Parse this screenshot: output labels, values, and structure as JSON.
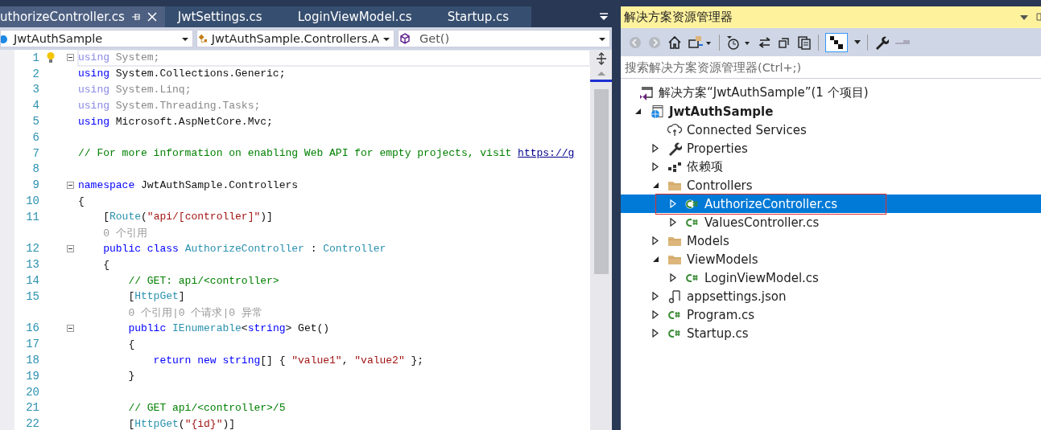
{
  "editor": {
    "tabs": [
      {
        "label": "uthorizeController.cs",
        "selected": true
      },
      {
        "label": "JwtSettings.cs",
        "selected": false
      },
      {
        "label": "LoginViewModel.cs",
        "selected": false
      },
      {
        "label": "Startup.cs",
        "selected": false
      }
    ],
    "nav": {
      "project": "JwtAuthSample",
      "type": "JwtAuthSample.Controllers.A",
      "member": "Get()"
    },
    "lines": [
      {
        "kind": "code",
        "number": "1",
        "fold": true,
        "current": true,
        "tokens": [
          {
            "kind": "unused_keyword",
            "s": "using"
          },
          {
            "kind": "unused",
            "s": " System;"
          }
        ]
      },
      {
        "kind": "code",
        "number": "2",
        "tokens": [
          {
            "kind": "keyword",
            "s": "using"
          },
          {
            "kind": "plain",
            "s": " System.Collections.Generic;"
          }
        ]
      },
      {
        "kind": "code",
        "number": "3",
        "tokens": [
          {
            "kind": "unused_keyword",
            "s": "using"
          },
          {
            "kind": "unused",
            "s": " System.Linq;"
          }
        ]
      },
      {
        "kind": "code",
        "number": "4",
        "tokens": [
          {
            "kind": "unused_keyword",
            "s": "using"
          },
          {
            "kind": "unused",
            "s": " System.Threading.Tasks;"
          }
        ]
      },
      {
        "kind": "code",
        "number": "5",
        "tokens": [
          {
            "kind": "keyword",
            "s": "using"
          },
          {
            "kind": "plain",
            "s": " Microsoft.AspNetCore.Mvc;"
          }
        ]
      },
      {
        "kind": "code",
        "number": "6"
      },
      {
        "kind": "code",
        "number": "7",
        "tokens": [
          {
            "kind": "comment",
            "s": "// For more information on enabling Web API for empty projects, visit "
          },
          {
            "kind": "link",
            "s": "https://g"
          }
        ]
      },
      {
        "kind": "code",
        "number": "8"
      },
      {
        "kind": "code",
        "number": "9",
        "fold": true,
        "tokens": [
          {
            "kind": "keyword",
            "s": "namespace"
          },
          {
            "kind": "plain",
            "s": " JwtAuthSample.Controllers"
          }
        ]
      },
      {
        "kind": "code",
        "number": "10",
        "tokens": [
          {
            "kind": "plain",
            "s": "{"
          }
        ]
      },
      {
        "kind": "code",
        "number": "11",
        "tokens": [
          {
            "kind": "plain",
            "s": "    ["
          },
          {
            "kind": "type",
            "s": "Route"
          },
          {
            "kind": "plain",
            "s": "("
          },
          {
            "kind": "string",
            "s": "\"api/[controller]\""
          },
          {
            "kind": "plain",
            "s": ")]"
          }
        ]
      },
      {
        "kind": "lens",
        "text": "    0 个引用"
      },
      {
        "kind": "code",
        "number": "12",
        "fold": true,
        "tokens": [
          {
            "kind": "keyword",
            "s": "    public class "
          },
          {
            "kind": "type",
            "s": "AuthorizeController"
          },
          {
            "kind": "plain",
            "s": " : "
          },
          {
            "kind": "type",
            "s": "Controller"
          }
        ]
      },
      {
        "kind": "code",
        "number": "13",
        "tokens": [
          {
            "kind": "plain",
            "s": "    {"
          }
        ]
      },
      {
        "kind": "code",
        "number": "14",
        "tokens": [
          {
            "kind": "comment",
            "s": "        // GET: api/<controller>"
          }
        ]
      },
      {
        "kind": "code",
        "number": "15",
        "tokens": [
          {
            "kind": "plain",
            "s": "        ["
          },
          {
            "kind": "type",
            "s": "HttpGet"
          },
          {
            "kind": "plain",
            "s": "]"
          }
        ]
      },
      {
        "kind": "lens",
        "text": "        0 个引用|0 个请求|0 异常"
      },
      {
        "kind": "code",
        "number": "16",
        "fold": true,
        "tokens": [
          {
            "kind": "keyword",
            "s": "        public "
          },
          {
            "kind": "type",
            "s": "IEnumerable"
          },
          {
            "kind": "plain",
            "s": "<"
          },
          {
            "kind": "keyword",
            "s": "string"
          },
          {
            "kind": "plain",
            "s": "> Get()"
          }
        ]
      },
      {
        "kind": "code",
        "number": "17",
        "tokens": [
          {
            "kind": "plain",
            "s": "        {"
          }
        ]
      },
      {
        "kind": "code",
        "number": "18",
        "tokens": [
          {
            "kind": "keyword",
            "s": "            return new string"
          },
          {
            "kind": "plain",
            "s": "[] { "
          },
          {
            "kind": "string",
            "s": "\"value1\""
          },
          {
            "kind": "plain",
            "s": ", "
          },
          {
            "kind": "string",
            "s": "\"value2\""
          },
          {
            "kind": "plain",
            "s": " };"
          }
        ]
      },
      {
        "kind": "code",
        "number": "19",
        "tokens": [
          {
            "kind": "plain",
            "s": "        }"
          }
        ]
      },
      {
        "kind": "code",
        "number": "20"
      },
      {
        "kind": "code",
        "number": "21",
        "tokens": [
          {
            "kind": "comment",
            "s": "        // GET api/<controller>/5"
          }
        ]
      },
      {
        "kind": "code",
        "number": "22",
        "tokens": [
          {
            "kind": "plain",
            "s": "        ["
          },
          {
            "kind": "type",
            "s": "HttpGet"
          },
          {
            "kind": "plain",
            "s": "("
          },
          {
            "kind": "string",
            "s": "\"{id}\""
          },
          {
            "kind": "plain",
            "s": ")]"
          }
        ]
      }
    ]
  },
  "explorer": {
    "title": "解决方案资源管理器",
    "search": {
      "placeholder": "搜索解决方案资源管理器(Ctrl+;)"
    },
    "tree": [
      {
        "label": "解决方案“JwtAuthSample”(1 个项目)",
        "kind": "solution",
        "selected": false,
        "children": [
          {
            "label": "JwtAuthSample",
            "kind": "project",
            "expanded": true,
            "selected": false,
            "children": [
              {
                "label": "Connected Services",
                "kind": "service",
                "selected": false
              },
              {
                "label": "Properties",
                "kind": "properties",
                "expanded": false,
                "selected": false
              },
              {
                "label": "依赖项",
                "kind": "deps",
                "expanded": false,
                "selected": false
              },
              {
                "label": "Controllers",
                "kind": "folder",
                "expanded": true,
                "selected": false,
                "children": [
                  {
                    "label": "AuthorizeController.cs",
                    "kind": "csfile",
                    "expanded": false,
                    "selected": true,
                    "outlined": true
                  },
                  {
                    "label": "ValuesController.cs",
                    "kind": "csfile",
                    "expanded": false,
                    "selected": false,
                    "outlined": false
                  }
                ]
              },
              {
                "label": "Models",
                "kind": "folder",
                "expanded": false,
                "selected": false
              },
              {
                "label": "ViewModels",
                "kind": "folder",
                "expanded": true,
                "selected": false,
                "children": [
                  {
                    "label": "LoginViewModel.cs",
                    "kind": "csfile",
                    "expanded": false,
                    "selected": false
                  }
                ]
              },
              {
                "label": "appsettings.json",
                "kind": "json",
                "expanded": false,
                "selected": false
              },
              {
                "label": "Program.cs",
                "kind": "csfile",
                "expanded": false,
                "selected": false
              },
              {
                "label": "Startup.cs",
                "kind": "csfile",
                "expanded": false,
                "selected": false
              }
            ]
          }
        ]
      }
    ]
  }
}
